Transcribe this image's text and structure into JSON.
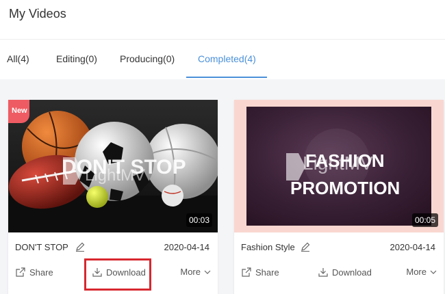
{
  "page": {
    "title": "My Videos"
  },
  "tabs": [
    {
      "label": "All(4)",
      "active": false
    },
    {
      "label": "Editing(0)",
      "active": false
    },
    {
      "label": "Producing(0)",
      "active": false
    },
    {
      "label": "Completed(4)",
      "active": true
    }
  ],
  "colors": {
    "accent": "#4a90d9",
    "new_badge": "#ef5b62",
    "highlight": "#d7272f"
  },
  "videos": [
    {
      "badge": "New",
      "thumbnail_text": [
        "DON'T STOP",
        "LightMV"
      ],
      "duration": "00:03",
      "name": "DON'T STOP",
      "date": "2020-04-14",
      "actions": {
        "share": "Share",
        "download": "Download",
        "more": "More"
      }
    },
    {
      "badge": "",
      "thumbnail_text": [
        "FASHION",
        "LightMV",
        "PROMOTION"
      ],
      "duration": "00:05",
      "name": "Fashion Style",
      "date": "2020-04-14",
      "actions": {
        "share": "Share",
        "download": "Download",
        "more": "More"
      }
    }
  ],
  "icons": {
    "edit": "pencil-icon",
    "share": "share-icon",
    "download": "download-icon",
    "more": "chevron-down-icon"
  }
}
